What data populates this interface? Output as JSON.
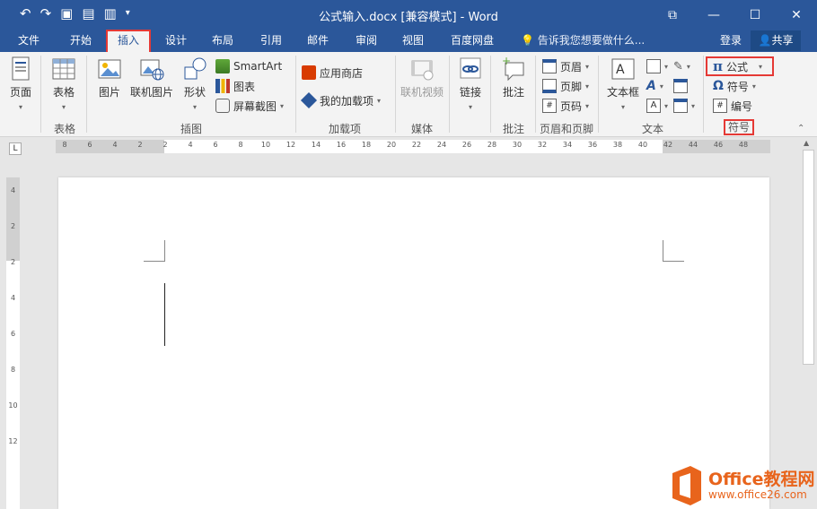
{
  "window": {
    "title": "公式输入.docx [兼容模式] - Word",
    "controls": [
      "⧉",
      "—",
      "☐",
      "✕"
    ]
  },
  "tabs": [
    {
      "label": "文件"
    },
    {
      "label": "开始"
    },
    {
      "label": "插入"
    },
    {
      "label": "设计"
    },
    {
      "label": "布局"
    },
    {
      "label": "引用"
    },
    {
      "label": "邮件"
    },
    {
      "label": "审阅"
    },
    {
      "label": "视图"
    },
    {
      "label": "百度网盘"
    }
  ],
  "tell_me": "告诉我您想要做什么...",
  "login": "登录",
  "share": "共享",
  "ribbon": {
    "page": "页面",
    "table": "表格",
    "picture": "图片",
    "online_picture": "联机图片",
    "shapes": "形状",
    "smartart": "SmartArt",
    "chart": "图表",
    "screenshot": "屏幕截图",
    "store": "应用商店",
    "my_addins": "我的加载项",
    "online_video": "联机视频",
    "link": "链接",
    "comment": "批注",
    "header": "页眉",
    "footer": "页脚",
    "page_number": "页码",
    "textbox": "文本框",
    "equation": "公式",
    "symbol": "符号",
    "numbering": "编号",
    "groups": {
      "tables": "表格",
      "illustrations": "插图",
      "addins": "加载项",
      "media": "媒体",
      "comments": "批注",
      "header_footer": "页眉和页脚",
      "text": "文本",
      "symbols": "符号"
    }
  },
  "ruler": {
    "h_ticks": [
      "8",
      "6",
      "4",
      "2",
      "2",
      "4",
      "6",
      "8",
      "10",
      "12",
      "14",
      "16",
      "18",
      "20",
      "22",
      "24",
      "26",
      "28",
      "30",
      "32",
      "34",
      "36",
      "38",
      "40",
      "42",
      "44",
      "46",
      "48"
    ],
    "v_ticks": [
      "4",
      "2",
      "2",
      "4",
      "6",
      "8",
      "10",
      "12"
    ],
    "corner": "L"
  },
  "watermark": {
    "brand": "Office教程网",
    "url": "www.office26.com"
  },
  "colors": {
    "accent": "#2b579a",
    "highlight": "#e53935",
    "watermark": "#e8641c"
  }
}
